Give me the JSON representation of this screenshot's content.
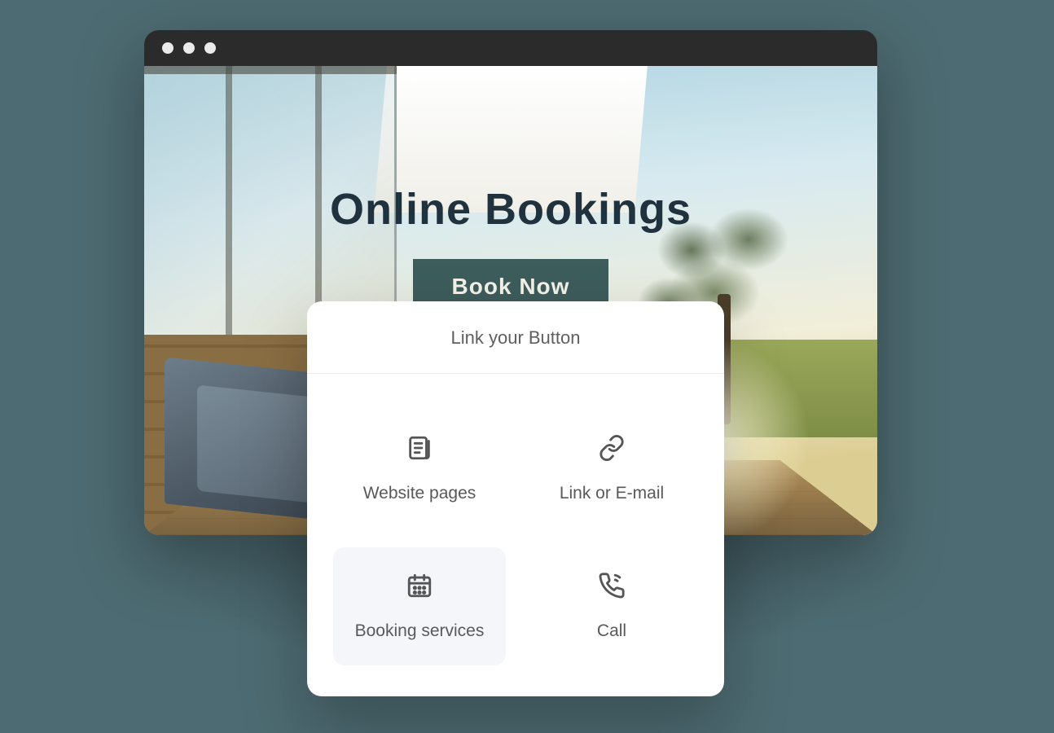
{
  "hero": {
    "title": "Online Bookings",
    "cta_label": "Book Now"
  },
  "popover": {
    "title": "Link your Button",
    "options": [
      {
        "label": "Website pages",
        "icon": "pages-icon",
        "selected": false
      },
      {
        "label": "Link or E-mail",
        "icon": "link-icon",
        "selected": false
      },
      {
        "label": "Booking services",
        "icon": "calendar-icon",
        "selected": true
      },
      {
        "label": "Call",
        "icon": "phone-icon",
        "selected": false
      }
    ]
  },
  "colors": {
    "page_bg": "#4d6b72",
    "cta_bg": "#3d5c5c",
    "title_color": "#20323d",
    "popover_selected_bg": "#f5f6fa"
  }
}
